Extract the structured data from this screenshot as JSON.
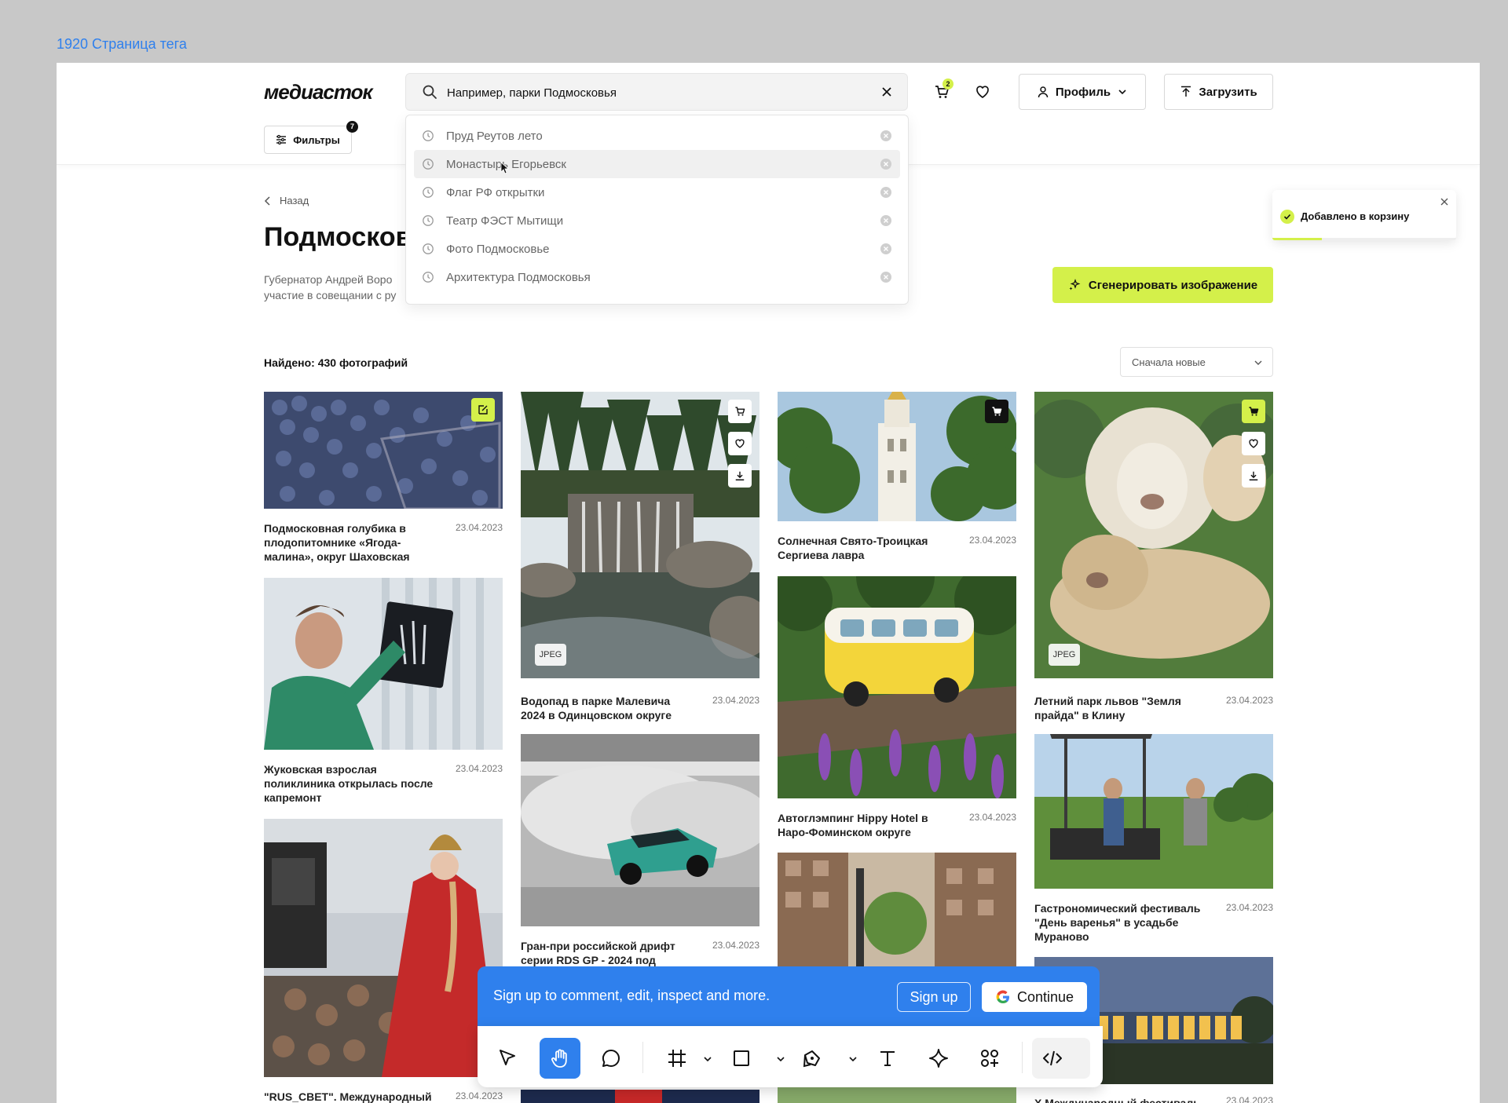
{
  "frame_label": "1920 Страница тега",
  "header": {
    "logo": "медиасток",
    "search_value": "Например, парки Подмосковья",
    "cart_count": "2",
    "profile_label": "Профиль",
    "upload_label": "Загрузить",
    "filters_label": "Фильтры",
    "filters_count": "7"
  },
  "search_history": [
    {
      "text": "Пруд Реутов лето"
    },
    {
      "text": "Монастырь Егорьевск"
    },
    {
      "text": "Флаг РФ открытки"
    },
    {
      "text": "Театр ФЭСТ Мытищи"
    },
    {
      "text": "Фото Подмосковье"
    },
    {
      "text": "Архитектура Подмосковья"
    }
  ],
  "page": {
    "back_label": "Назад",
    "title": "Подмосков",
    "description_line1": "Губернатор Андрей Воро",
    "description_line2": "участие в совещании с ру",
    "generate_label": "Сгенерировать изображение",
    "found_label": "Найдено: 430 фотографий",
    "sort_value": "Сначала новые"
  },
  "toast": {
    "message": "Добавлено в корзину",
    "progress": 0.27
  },
  "cards": [
    {
      "caption": "Подмосковная голубика в плодопитомнике «Ягода-малина», округ Шаховская",
      "date": "23.04.2023"
    },
    {
      "caption": "Жуковская взрослая поликлиника открылась после капремонт",
      "date": "23.04.2023"
    },
    {
      "caption": "\"RUS_CBET\". Международный",
      "date": "23.04.2023"
    },
    {
      "caption": "Водопад в парке Малевича 2024 в Одинцовском округе",
      "date": "23.04.2023",
      "badge": "JPEG"
    },
    {
      "caption": "Гран-при российской дрифт серии RDS GP - 2024 под",
      "date": "23.04.2023"
    },
    {
      "caption": "Солнечная Свято-Троицкая Сергиева лавра",
      "date": "23.04.2023"
    },
    {
      "caption": "Автоглэмпинг Hippy Hotel в Наро-Фоминском округе",
      "date": "23.04.2023"
    },
    {
      "caption": "Летний парк львов \"Земля прайда\" в Клину",
      "date": "23.04.2023",
      "badge": "JPEG"
    },
    {
      "caption": "Гастрономический фестиваль \"День варенья\" в усадьбе Мураново",
      "date": "23.04.2023"
    },
    {
      "caption": "X Международный фестиваль",
      "date": "23.04.2023"
    }
  ],
  "signup_bar": {
    "text": "Sign up to comment, edit, inspect and more.",
    "signup_label": "Sign up",
    "continue_label": "Continue"
  },
  "colors": {
    "accent": "#d4f04a",
    "figma_blue": "#2f80ed"
  }
}
